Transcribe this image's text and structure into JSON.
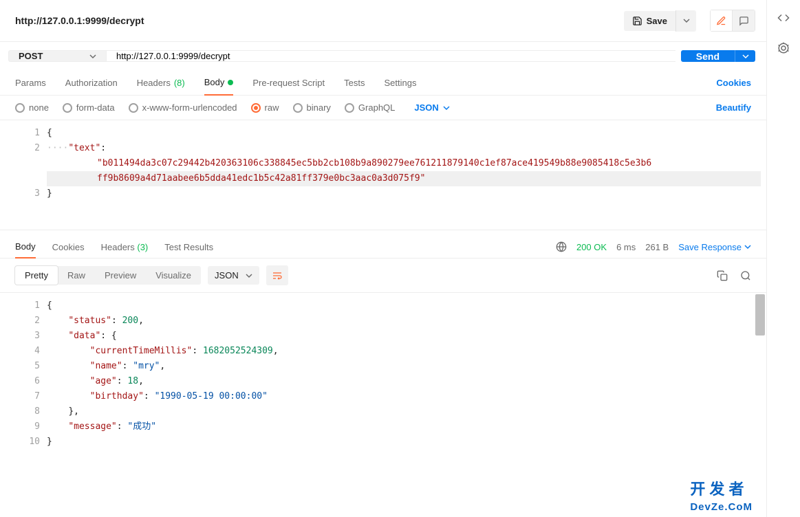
{
  "header": {
    "title": "http://127.0.0.1:9999/decrypt",
    "save_label": "Save"
  },
  "request": {
    "method": "POST",
    "url": "http://127.0.0.1:9999/decrypt",
    "send_label": "Send"
  },
  "reqTabs": {
    "params": "Params",
    "authorization": "Authorization",
    "headers": "Headers",
    "headers_count": "(8)",
    "body": "Body",
    "prerequest": "Pre-request Script",
    "tests": "Tests",
    "settings": "Settings",
    "cookies": "Cookies"
  },
  "bodyTypes": {
    "none": "none",
    "formdata": "form-data",
    "xwww": "x-www-form-urlencoded",
    "raw": "raw",
    "binary": "binary",
    "graphql": "GraphQL",
    "format": "JSON",
    "beautify": "Beautify"
  },
  "reqEditor": {
    "l1": "{",
    "l2_key": "\"text\"",
    "l2_val_a": "\"b011494da3c07c29442b420363106c338845ec5bb2cb108b9a890279ee761211879140c1ef87ace419549b88e9085418c5e3b6",
    "l2_val_b": "ff9b8609a4d71aabee6b5dda41edc1b5c42a81ff379e0bc3aac0a3d075f9\"",
    "l3": "}"
  },
  "respTabs": {
    "body": "Body",
    "cookies": "Cookies",
    "headers": "Headers",
    "headers_count": "(3)",
    "tests": "Test Results"
  },
  "respMeta": {
    "status": "200 OK",
    "time": "6 ms",
    "size": "261 B",
    "save": "Save Response"
  },
  "viewBar": {
    "pretty": "Pretty",
    "raw": "Raw",
    "preview": "Preview",
    "visualize": "Visualize",
    "format": "JSON"
  },
  "response": {
    "l1": "{",
    "l2k": "\"status\"",
    "l2v": "200",
    "l3k": "\"data\"",
    "l4k": "\"currentTimeMillis\"",
    "l4v": "1682052524309",
    "l5k": "\"name\"",
    "l5v": "\"mry\"",
    "l6k": "\"age\"",
    "l6v": "18",
    "l7k": "\"birthday\"",
    "l7v": "\"1990-05-19 00:00:00\"",
    "l8": "},",
    "l9k": "\"message\"",
    "l9v": "\"成功\"",
    "l10": "}"
  },
  "watermark": {
    "line1": "开 发 者",
    "line2": "DevZe.CoM"
  }
}
